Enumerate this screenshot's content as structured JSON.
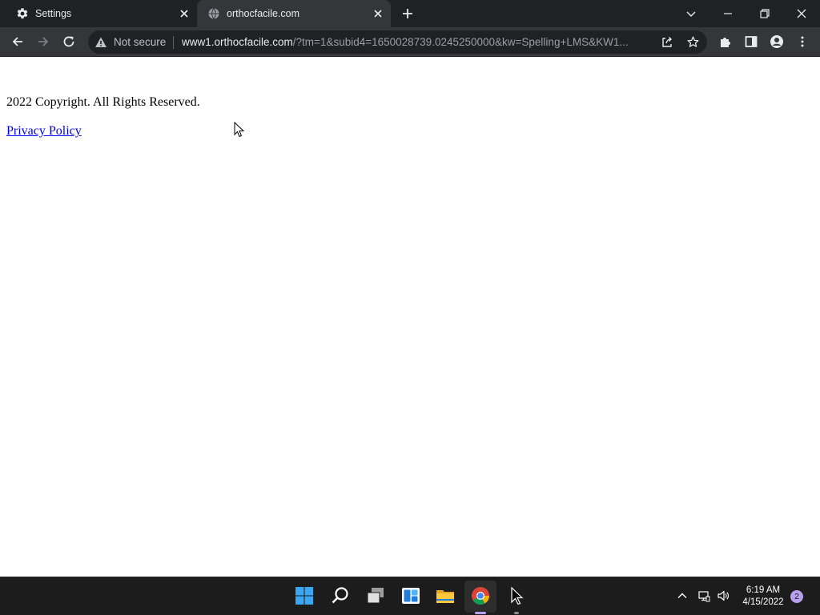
{
  "browser": {
    "tabs": [
      {
        "title": "Settings",
        "icon": "gear-icon",
        "active": false
      },
      {
        "title": "orthocfacile.com",
        "icon": "globe-icon",
        "active": true
      }
    ],
    "address_bar": {
      "security_label": "Not secure",
      "url_host": "www1.orthocfacile.com",
      "url_rest": "/?tm=1&subid4=1650028739.0245250000&kw=Spelling+LMS&KW1..."
    }
  },
  "page": {
    "copyright": "2022 Copyright. All Rights Reserved.",
    "privacy_link": "Privacy Policy"
  },
  "taskbar": {
    "time": "6:19 AM",
    "date": "4/15/2022",
    "notification_count": "2",
    "apps": [
      "start-icon",
      "search-icon",
      "task-view-icon",
      "widgets-icon",
      "file-explorer-icon",
      "chrome-icon",
      "app-arrow-icon"
    ]
  },
  "colors": {
    "tabstrip_bg": "#202124",
    "toolbar_bg": "#35363a",
    "omnibox_bg": "#202124",
    "link": "#0000ee",
    "taskbar_bg": "#1c1c1c",
    "accent": "#b7a1ee"
  }
}
